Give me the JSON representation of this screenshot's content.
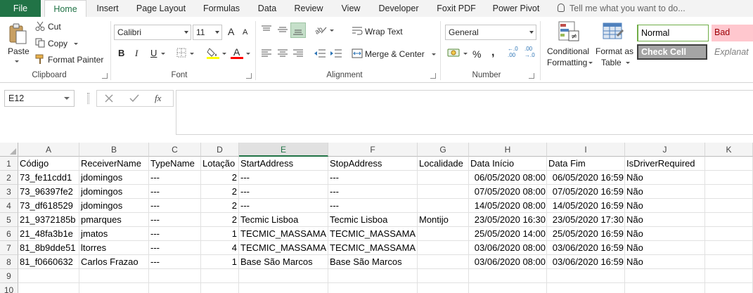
{
  "ribbon_tabs": [
    "File",
    "Home",
    "Insert",
    "Page Layout",
    "Formulas",
    "Data",
    "Review",
    "View",
    "Developer",
    "Foxit PDF",
    "Power Pivot"
  ],
  "active_tab": "Home",
  "tell_me": "Tell me what you want to do...",
  "clipboard": {
    "paste": "Paste",
    "cut": "Cut",
    "copy": "Copy",
    "format_painter": "Format Painter",
    "group_label": "Clipboard"
  },
  "font": {
    "family": "Calibri",
    "size": "11",
    "bold": "B",
    "italic": "I",
    "underline": "U",
    "grow": "A",
    "shrink": "A",
    "color_letter": "A",
    "group_label": "Font"
  },
  "alignment": {
    "wrap_text": "Wrap Text",
    "merge_center": "Merge & Center",
    "group_label": "Alignment"
  },
  "number": {
    "format": "General",
    "percent": "%",
    "comma": ",",
    "inc_decimal": "←.0 .00",
    "dec_decimal": ".00 →.0",
    "group_label": "Number"
  },
  "styles": {
    "conditional_formatting": [
      "Conditional",
      "Formatting"
    ],
    "format_as_table": [
      "Format as",
      "Table"
    ],
    "normal": "Normal",
    "bad": "Bad",
    "check_cell": "Check Cell",
    "explanatory": "Explanat"
  },
  "formula_bar": {
    "name_box": "E12",
    "fx": "fx",
    "value": ""
  },
  "columns": [
    "A",
    "B",
    "C",
    "D",
    "E",
    "F",
    "G",
    "H",
    "I",
    "J",
    "K"
  ],
  "selected_column": "E",
  "row_numbers": [
    "1",
    "2",
    "3",
    "4",
    "5",
    "6",
    "7",
    "8",
    "9",
    "10"
  ],
  "header_row": [
    "Código",
    "ReceiverName",
    "TypeName",
    "Lotação",
    "StartAddress",
    "StopAddress",
    "Localidade",
    "Data Início",
    "Data Fim",
    "IsDriverRequired",
    ""
  ],
  "rows": [
    [
      "73_fe11cdd1",
      "jdomingos",
      "---",
      "2",
      "---",
      "---",
      "",
      "06/05/2020 08:00",
      "06/05/2020 16:59",
      "Não",
      ""
    ],
    [
      "73_96397fe2",
      "jdomingos",
      "---",
      "2",
      "---",
      "---",
      "",
      "07/05/2020 08:00",
      "07/05/2020 16:59",
      "Não",
      ""
    ],
    [
      "73_df618529",
      "jdomingos",
      "---",
      "2",
      "---",
      "---",
      "",
      "14/05/2020 08:00",
      "14/05/2020 16:59",
      "Não",
      ""
    ],
    [
      "21_9372185b",
      "pmarques",
      "---",
      "2",
      "Tecmic Lisboa",
      "Tecmic Lisboa",
      "Montijo",
      "23/05/2020 16:30",
      "23/05/2020 17:30",
      "Não",
      ""
    ],
    [
      "21_48fa3b1e",
      "jmatos",
      "---",
      "1",
      "TECMIC_MASSAMA",
      "TECMIC_MASSAMA",
      "",
      "25/05/2020 14:00",
      "25/05/2020 16:59",
      "Não",
      ""
    ],
    [
      "81_8b9dde51",
      "ltorres",
      "---",
      "4",
      "TECMIC_MASSAMA",
      "TECMIC_MASSAMA",
      "",
      "03/06/2020 08:00",
      "03/06/2020 16:59",
      "Não",
      ""
    ],
    [
      "81_f0660632",
      "Carlos Frazao",
      "---",
      "1",
      "Base São Marcos",
      "Base São Marcos",
      "",
      "03/06/2020 08:00",
      "03/06/2020 16:59",
      "Não",
      ""
    ],
    [
      "",
      "",
      "",
      "",
      "",
      "",
      "",
      "",
      "",
      "",
      ""
    ],
    [
      "",
      "",
      "",
      "",
      "",
      "",
      "",
      "",
      "",
      "",
      ""
    ]
  ],
  "colors": {
    "excel_green": "#217346",
    "normal_border": "#70ad47",
    "bad_fill": "#ffc7ce",
    "bad_text": "#9c0006",
    "check_fill": "#a5a5a5",
    "font_color": "#ff0000",
    "highlight": "#ffff00"
  }
}
